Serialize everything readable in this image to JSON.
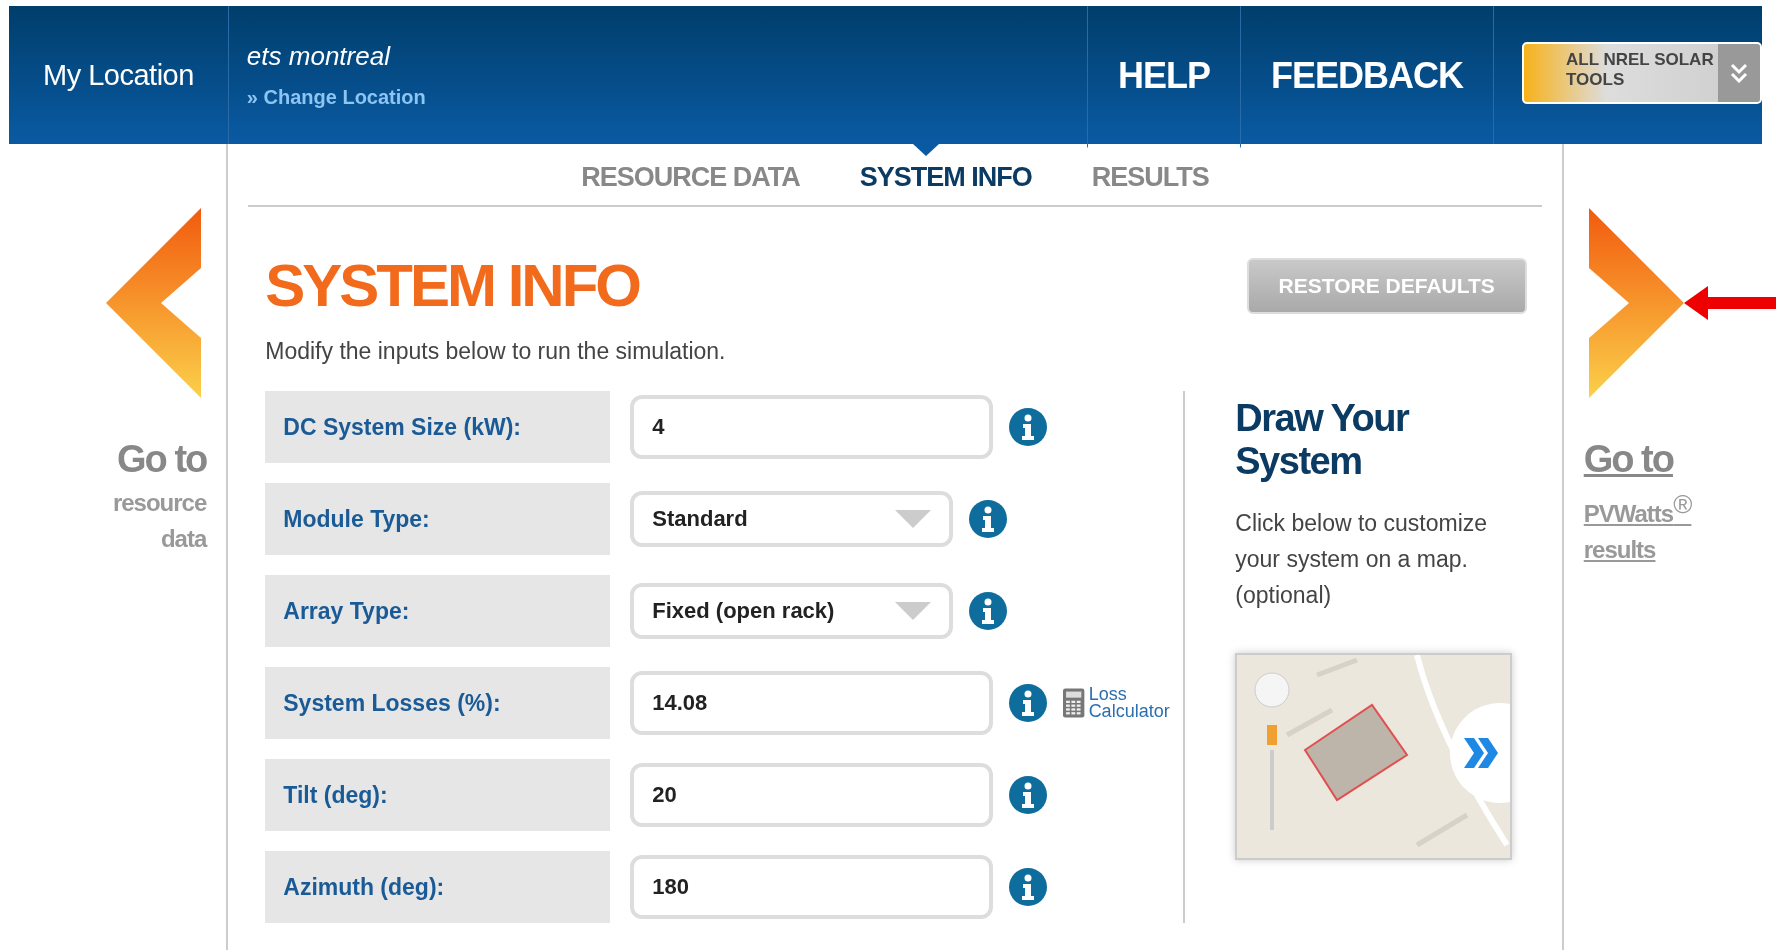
{
  "header": {
    "location_label": "My Location",
    "location_name": "ets montreal",
    "change_location": "» Change Location",
    "nav": [
      "HELP",
      "FEEDBACK"
    ],
    "tools_button": "ALL NREL SOLAR TOOLS"
  },
  "left_nav": {
    "go": "Go to",
    "lines": [
      "resource",
      "data"
    ]
  },
  "right_nav": {
    "go": "Go to",
    "lines": [
      "PVWatts$^{®}$",
      "results"
    ]
  },
  "tabs": [
    {
      "label": "RESOURCE DATA",
      "selected": false
    },
    {
      "label": "SYSTEM INFO",
      "selected": true
    },
    {
      "label": "RESULTS",
      "selected": false
    }
  ],
  "title": "SYSTEM INFO",
  "restore_button": "RESTORE DEFAULTS",
  "subtitle": "Modify the inputs below to run the simulation.",
  "fields": [
    {
      "label": "DC System Size (kW):",
      "kind": "text",
      "value": "4"
    },
    {
      "label": "Module Type:",
      "kind": "select",
      "value": "Standard"
    },
    {
      "label": "Array Type:",
      "kind": "select",
      "value": "Fixed (open rack)"
    },
    {
      "label": "System Losses (%):",
      "kind": "text",
      "value": "14.08",
      "link": "Loss Calculator"
    },
    {
      "label": "Tilt (deg):",
      "kind": "text",
      "value": "20"
    },
    {
      "label": "Azimuth (deg):",
      "kind": "text",
      "value": "180"
    }
  ],
  "draw_panel": {
    "title": "Draw Your System",
    "text": "Click below to customize your system on a map. (optional)"
  }
}
